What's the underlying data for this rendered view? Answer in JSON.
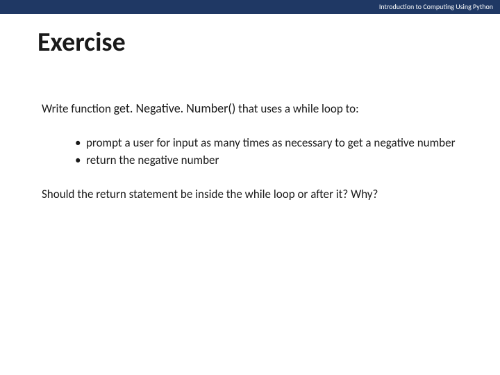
{
  "header": {
    "course": "Introduction to Computing Using Python"
  },
  "title": "Exercise",
  "intro": {
    "prefix": "Write function ",
    "fn_name": "get. Negative. Number()",
    "suffix": " that uses a while loop to:"
  },
  "bullets": [
    "prompt a user for input as many times as necessary to get a negative number",
    "return the negative number"
  ],
  "question": "Should the return statement be inside the while loop or after it? Why?"
}
